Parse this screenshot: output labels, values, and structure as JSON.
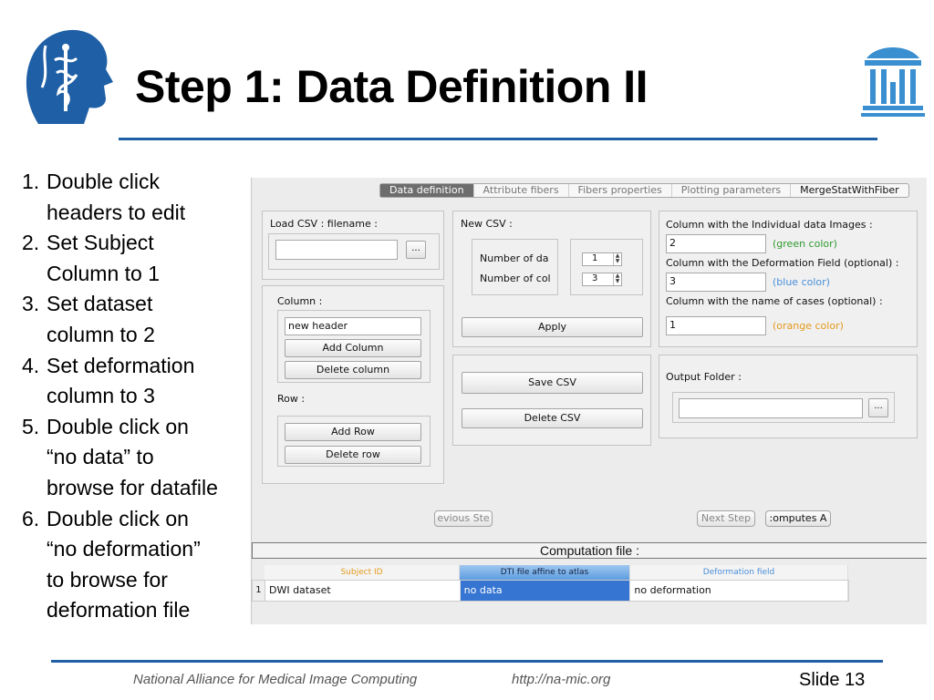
{
  "slide": {
    "title": "Step 1: Data Definition II",
    "steps": [
      {
        "num": "1.",
        "text": "Double click\nheaders to edit"
      },
      {
        "num": "2.",
        "text": "Set Subject\nColumn to 1"
      },
      {
        "num": "3.",
        "text": "Set dataset\ncolumn to 2"
      },
      {
        "num": "4.",
        "text": "Set deformation\ncolumn to 3"
      },
      {
        "num": "5.",
        "text": "Double click on\n“no data” to\nbrowse for datafile"
      },
      {
        "num": "6.",
        "text": "Double click on\n“no deformation”\nto browse for\ndeformation file"
      }
    ],
    "footer": {
      "org": "National Alliance for Medical Image Computing",
      "url": "http://na-mic.org",
      "slide_number": "Slide 13"
    },
    "colors": {
      "accent": "#1f5fa6",
      "logo_blue": "#1f5fa6",
      "logo_right": "#3a8fd0"
    },
    "icons": [
      "namic-head-logo",
      "unc-old-well-logo"
    ]
  },
  "app": {
    "tabs": [
      {
        "label": "Data definition",
        "active": true
      },
      {
        "label": "Attribute fibers",
        "active": false
      },
      {
        "label": "Fibers properties",
        "active": false
      },
      {
        "label": "Plotting parameters",
        "active": false
      },
      {
        "label": "MergeStatWithFiber",
        "active": false
      }
    ],
    "load_csv": {
      "title": "Load CSV : filename :",
      "value": "",
      "browse_label": "..."
    },
    "column": {
      "title": "Column :",
      "header_value": "new header",
      "add_label": "Add Column",
      "delete_label": "Delete column"
    },
    "row": {
      "title": "Row :",
      "add_label": "Add Row",
      "delete_label": "Delete row"
    },
    "new_csv": {
      "title": "New CSV :",
      "rows_label": "Number of da",
      "cols_label": "Number of col",
      "rows_value": "1",
      "cols_value": "3",
      "apply_label": "Apply"
    },
    "csv_actions": {
      "save_label": "Save CSV",
      "delete_label": "Delete CSV"
    },
    "columns_config": {
      "images_label": "Column with the Individual data Images :",
      "images_value": "2",
      "images_hint": "(green color)",
      "deform_label": "Column with the Deformation Field (optional) :",
      "deform_value": "3",
      "deform_hint": "(blue color)",
      "cases_label": "Column with the name of cases (optional) :",
      "cases_value": "1",
      "cases_hint": "(orange color)"
    },
    "output": {
      "title": "Output Folder :",
      "value": "",
      "browse_label": "..."
    },
    "nav": {
      "previous_label": "evious Ste",
      "next_label": "Next Step",
      "compute_label": ":omputes A"
    },
    "computation_title": "Computation file :",
    "table": {
      "headers": [
        "Subject ID",
        "DTI file affine to atlas",
        "Deformation field"
      ],
      "rows": [
        {
          "num": "1",
          "cells": [
            "DWI dataset",
            "no data",
            "no deformation"
          ]
        }
      ]
    },
    "colors": {
      "green_hint": "#2e9a2e",
      "blue_hint": "#4a8fd8",
      "orange_hint": "#e49a1c",
      "selection": "#3675d1"
    }
  }
}
